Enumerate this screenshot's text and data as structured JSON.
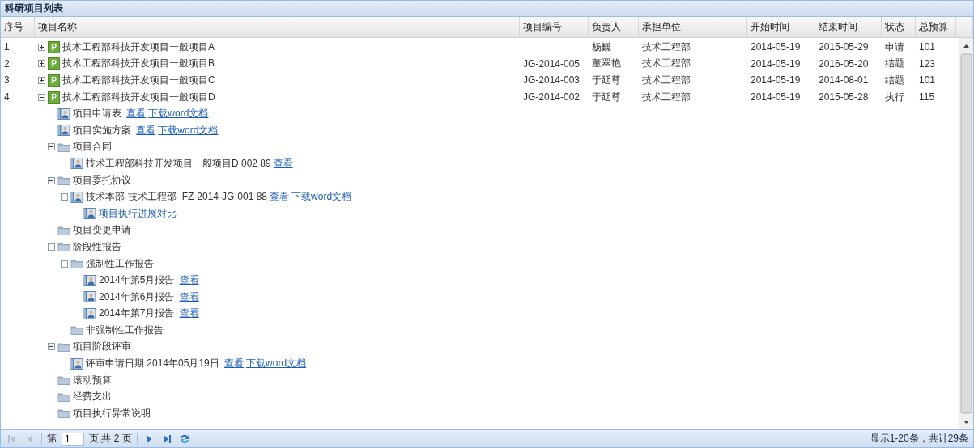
{
  "title": "科研项目列表",
  "columns": [
    "序号",
    "项目名称",
    "项目编号",
    "负责人",
    "承担单位",
    "开始时间",
    "结束时间",
    "状态",
    "总预算"
  ],
  "projects": [
    {
      "index": "1",
      "badge": "P",
      "name": "技术工程部科技开发项目一般项目A",
      "expanded": false,
      "owner": "杨巍",
      "unit": "技术工程部",
      "start": "2014-05-19",
      "end": "2015-05-29",
      "status": "申请",
      "budget": "101"
    },
    {
      "index": "2",
      "badge": "P",
      "name": "技术工程部科技开发项目一般项目B",
      "expanded": false,
      "code": "JG-2014-005",
      "owner": "董翠艳",
      "unit": "技术工程部",
      "start": "2014-05-19",
      "end": "2016-05-20",
      "status": "结题",
      "budget": "123"
    },
    {
      "index": "3",
      "badge": "P",
      "name": "技术工程部科技开发项目一般项目C",
      "expanded": false,
      "code": "JG-2014-003",
      "owner": "于延尊",
      "unit": "技术工程部",
      "start": "2014-05-19",
      "end": "2014-08-01",
      "status": "结题",
      "budget": "101"
    },
    {
      "index": "4",
      "badge": "P",
      "name": "技术工程部科技开发项目一般项目D",
      "expanded": true,
      "code": "JG-2014-002",
      "owner": "于延尊",
      "unit": "技术工程部",
      "start": "2014-05-19",
      "end": "2015-05-28",
      "status": "执行",
      "budget": "115",
      "children": [
        {
          "kind": "doc",
          "label": "项目申请表 ",
          "links": [
            "查看",
            "下载word文档"
          ]
        },
        {
          "kind": "doc",
          "label": "项目实施方案 ",
          "links": [
            "查看",
            "下载word文档"
          ]
        },
        {
          "kind": "folder",
          "label": "项目合同",
          "expanded": true,
          "children": [
            {
              "kind": "doc",
              "label": "技术工程部科技开发项目一般项目D 002 89",
              "links": [
                "查看"
              ]
            }
          ]
        },
        {
          "kind": "folder",
          "label": "项目委托协议",
          "expanded": true,
          "children": [
            {
              "kind": "doc",
              "label": "技术本部-技术工程部  FZ-2014-JG-001 88",
              "expanded": true,
              "links": [
                "查看",
                "下载word文档"
              ],
              "children": [
                {
                  "kind": "doc",
                  "label": "项目执行进展对比",
                  "linked": true
                }
              ]
            }
          ]
        },
        {
          "kind": "folder",
          "label": "项目变更申请"
        },
        {
          "kind": "folder",
          "label": "阶段性报告",
          "expanded": true,
          "children": [
            {
              "kind": "folder",
              "label": "强制性工作报告",
              "expanded": true,
              "children": [
                {
                  "kind": "doc",
                  "label": "2014年第5月报告 ",
                  "links": [
                    "查看"
                  ]
                },
                {
                  "kind": "doc",
                  "label": "2014年第6月报告 ",
                  "links": [
                    "查看"
                  ]
                },
                {
                  "kind": "doc",
                  "label": "2014年第7月报告 ",
                  "links": [
                    "查看"
                  ]
                }
              ]
            },
            {
              "kind": "folder",
              "label": "非强制性工作报告"
            }
          ]
        },
        {
          "kind": "folder",
          "label": "项目阶段评审",
          "expanded": true,
          "children": [
            {
              "kind": "doc",
              "label": "评审申请日期:2014年05月19日 ",
              "links": [
                "查看",
                "下载word文档"
              ]
            }
          ]
        },
        {
          "kind": "folder",
          "label": "滚动预算"
        },
        {
          "kind": "folder",
          "label": "经费支出"
        },
        {
          "kind": "folder",
          "label": "项目执行异常说明"
        }
      ]
    }
  ],
  "pager": {
    "buttons": [
      {
        "kind": "first",
        "disabled": true
      },
      {
        "kind": "prev",
        "disabled": true
      }
    ],
    "before": "第",
    "page": "1",
    "after": "页,共 2 页",
    "more": [
      {
        "kind": "next",
        "disabled": false
      },
      {
        "kind": "last",
        "disabled": false
      },
      {
        "kind": "refresh",
        "disabled": false
      }
    ],
    "summary": "显示1-20条，共计29条"
  }
}
